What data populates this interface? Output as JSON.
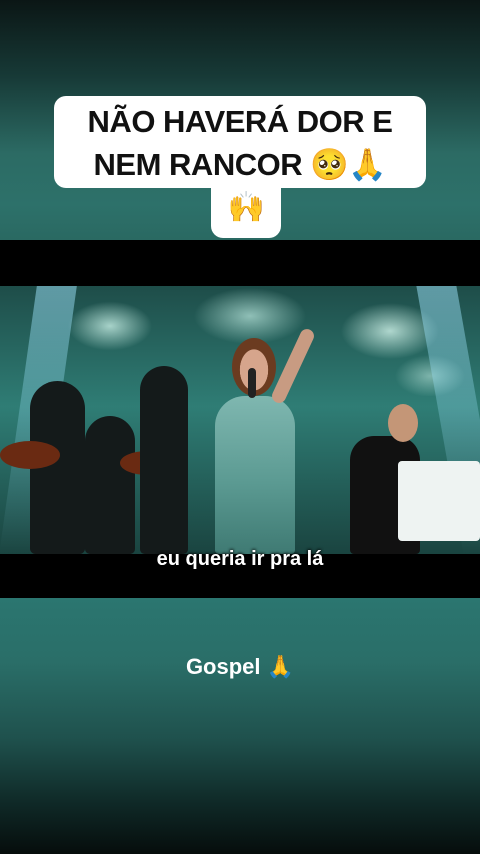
{
  "caption": {
    "line1": "NÃO HAVERÁ DOR E",
    "line2_text": "NEM RANCOR",
    "line2_emoji": "🥺🙏",
    "line3_emoji": "🙌"
  },
  "video": {
    "subtitle": "eu queria ir pra lá"
  },
  "footer": {
    "label": "Gospel",
    "emoji": "🙏"
  },
  "colors": {
    "teal": "#2d716a",
    "caption_bg": "#ffffff",
    "caption_text": "#111111"
  }
}
